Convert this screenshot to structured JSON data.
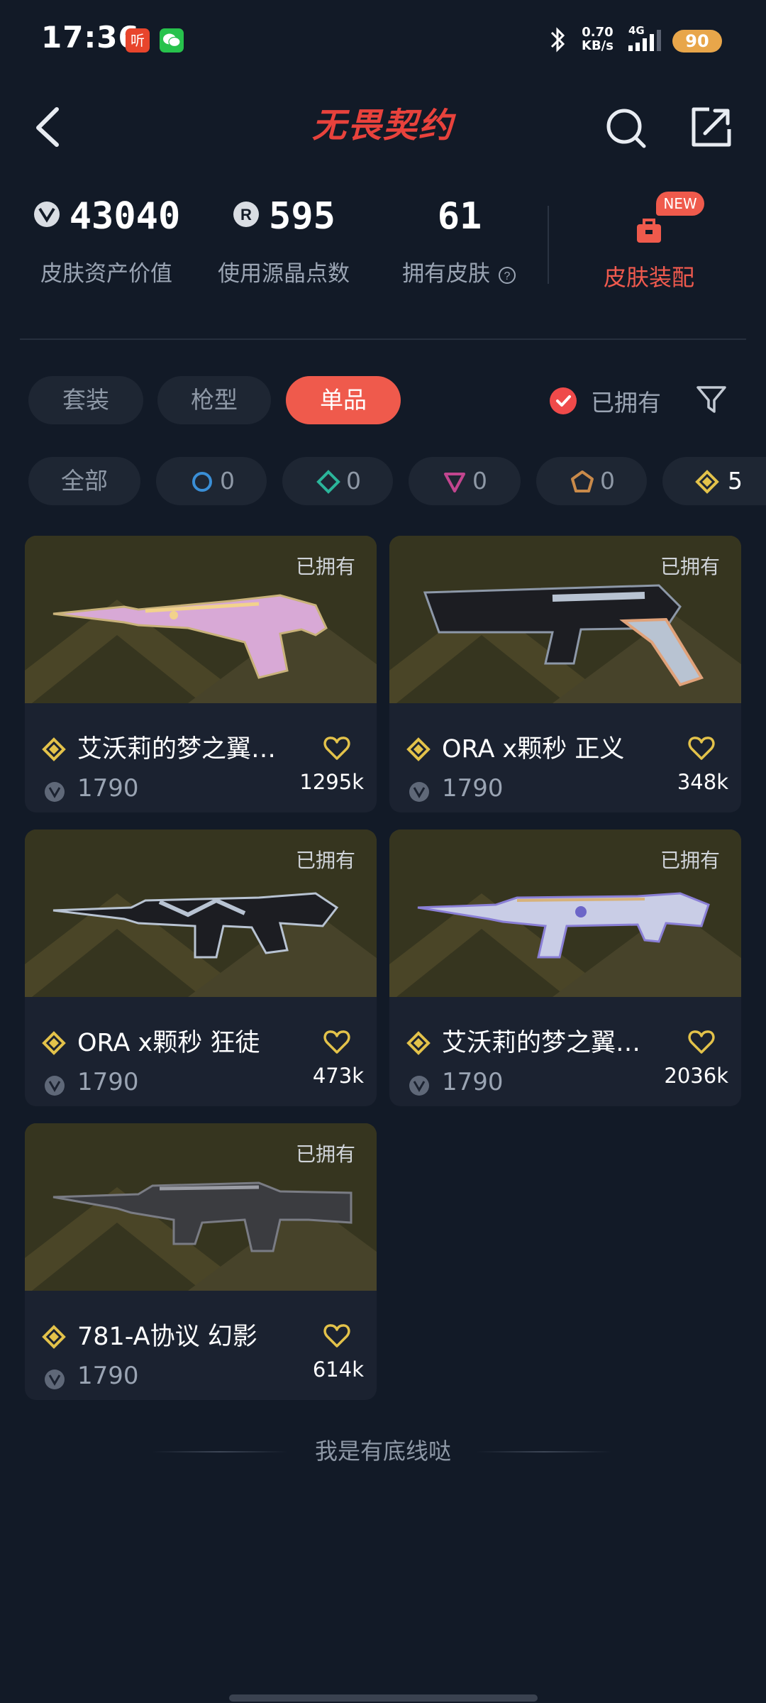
{
  "status_bar": {
    "time": "17:36",
    "app1_glyph": "听",
    "speed_value": "0.70",
    "speed_unit": "KB/s",
    "network": "4G",
    "battery": "90"
  },
  "nav": {
    "title": "无畏契约",
    "back_icon": "chevron-left-icon",
    "search_icon": "search-icon",
    "share_icon": "share-icon"
  },
  "stats": {
    "asset_value": "43040",
    "asset_label": "皮肤资产价值",
    "points_value": "595",
    "points_label": "使用源晶点数",
    "skins_value": "61",
    "skins_label": "拥有皮肤",
    "equip_label": "皮肤装配",
    "new_badge": "NEW"
  },
  "tabs": [
    "套装",
    "枪型",
    "单品"
  ],
  "active_tab": "单品",
  "owned_filter": {
    "label": "已拥有",
    "checked": true
  },
  "rarity_chips": [
    {
      "label": "全部"
    },
    {
      "icon": "select-tier-icon",
      "count": "0",
      "color": "#3a8ed6"
    },
    {
      "icon": "deluxe-tier-icon",
      "count": "0",
      "color": "#2bb59a"
    },
    {
      "icon": "premium-tier-icon",
      "count": "0",
      "color": "#c2458f"
    },
    {
      "icon": "exclusive-tier-icon",
      "count": "0",
      "color": "#c98a4a"
    },
    {
      "icon": "ultra-tier-icon",
      "count": "5",
      "color": "#e3c24a"
    }
  ],
  "cards": [
    {
      "owned": "已拥有",
      "name": "艾沃莉的梦之翼…",
      "price": "1790",
      "likes": "1295k"
    },
    {
      "owned": "已拥有",
      "name": "ORA x颗秒 正义",
      "price": "1790",
      "likes": "348k"
    },
    {
      "owned": "已拥有",
      "name": "ORA x颗秒 狂徒",
      "price": "1790",
      "likes": "473k"
    },
    {
      "owned": "已拥有",
      "name": "艾沃莉的梦之翼…",
      "price": "1790",
      "likes": "2036k"
    },
    {
      "owned": "已拥有",
      "name": "781-A协议 幻影",
      "price": "1790",
      "likes": "614k"
    }
  ],
  "footer": "我是有底线哒",
  "colors": {
    "accent": "#ef5a4c",
    "background": "#121a27",
    "gold": "#e3c24a"
  }
}
